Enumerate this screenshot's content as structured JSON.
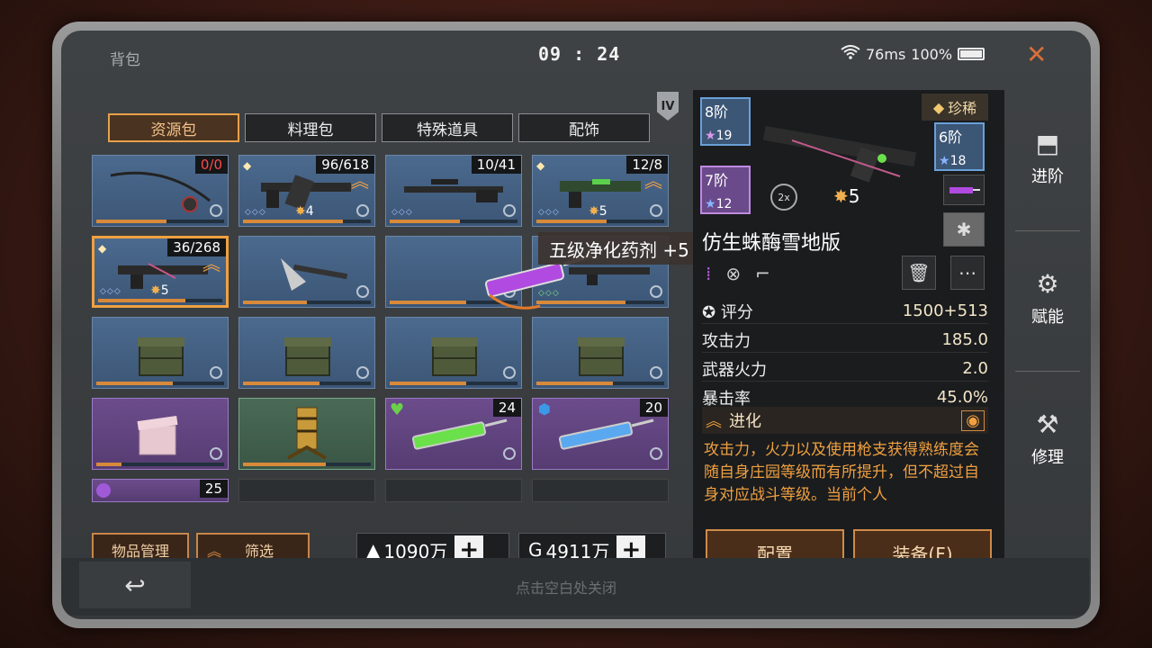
{
  "status": {
    "title": "背包",
    "time": "09 : 24",
    "ping": "76ms",
    "battery": "100%"
  },
  "tabs": [
    {
      "label": "资源包",
      "active": true
    },
    {
      "label": "料理包",
      "active": false
    },
    {
      "label": "特殊道具",
      "active": false
    },
    {
      "label": "配饰",
      "active": false
    }
  ],
  "tier_badge": "IV",
  "grid_items": [
    {
      "name": "fishing-rod",
      "count": "0/0",
      "count_red": true,
      "bar": 0.55
    },
    {
      "name": "rifle-item",
      "count": "96/618",
      "stars": "4",
      "bar": 0.78
    },
    {
      "name": "sniper-rifle",
      "count": "10/41",
      "bar": 0.55
    },
    {
      "name": "green-rifle",
      "count": "12/8",
      "stars": "5",
      "bar": 0.55
    },
    {
      "name": "selected-rifle",
      "count": "36/268",
      "stars": "5",
      "bar": 0.7
    },
    {
      "name": "axe",
      "bar": 0.5
    },
    {
      "name": "potion-item",
      "bar": 0.6
    },
    {
      "name": "gun-item",
      "bar": 0.7
    },
    {
      "name": "crate-1",
      "bar": 0.6
    },
    {
      "name": "crate-2",
      "bar": 0.6
    },
    {
      "name": "crate-3",
      "bar": 0.6
    },
    {
      "name": "crate-4",
      "bar": 0.6
    },
    {
      "name": "pink-box",
      "bar": 0.2
    },
    {
      "name": "golden-totem",
      "bar": 0.65
    },
    {
      "name": "green-syringe",
      "count": "24"
    },
    {
      "name": "blue-syringe",
      "count": "20"
    },
    {
      "name": "partial-item",
      "count": "25"
    }
  ],
  "tooltip": "五级净化药剂 +5",
  "bottom": {
    "manage_label": "物品管理",
    "filter_label": "筛选",
    "currency1": "1090万",
    "currency2": "4911万",
    "close_hint": "点击空白处关闭"
  },
  "detail": {
    "thumbs": [
      {
        "level": "8阶",
        "sub": "19"
      },
      {
        "level": "7阶",
        "sub": "12"
      },
      {
        "level": "6阶",
        "sub": "18"
      }
    ],
    "star_count": "5",
    "rarity": "珍稀",
    "weapon_name": "仿生蛛酶雪地版",
    "stats": [
      {
        "label": "评分",
        "value": "1500+513"
      },
      {
        "label": "攻击力",
        "value": "185.0"
      },
      {
        "label": "武器火力",
        "value": "2.0"
      },
      {
        "label": "暴击率",
        "value": "45.0%"
      }
    ],
    "evolution_label": "进化",
    "evolution_desc": "攻击力，火力以及使用枪支获得熟练度会随自身庄园等级而有所提升，但不超过自身对应战斗等级。当前个人",
    "config_label": "配置",
    "equip_label": "装备(F)"
  },
  "side_menu": [
    {
      "label": "进阶"
    },
    {
      "label": "赋能"
    },
    {
      "label": "修理"
    }
  ]
}
